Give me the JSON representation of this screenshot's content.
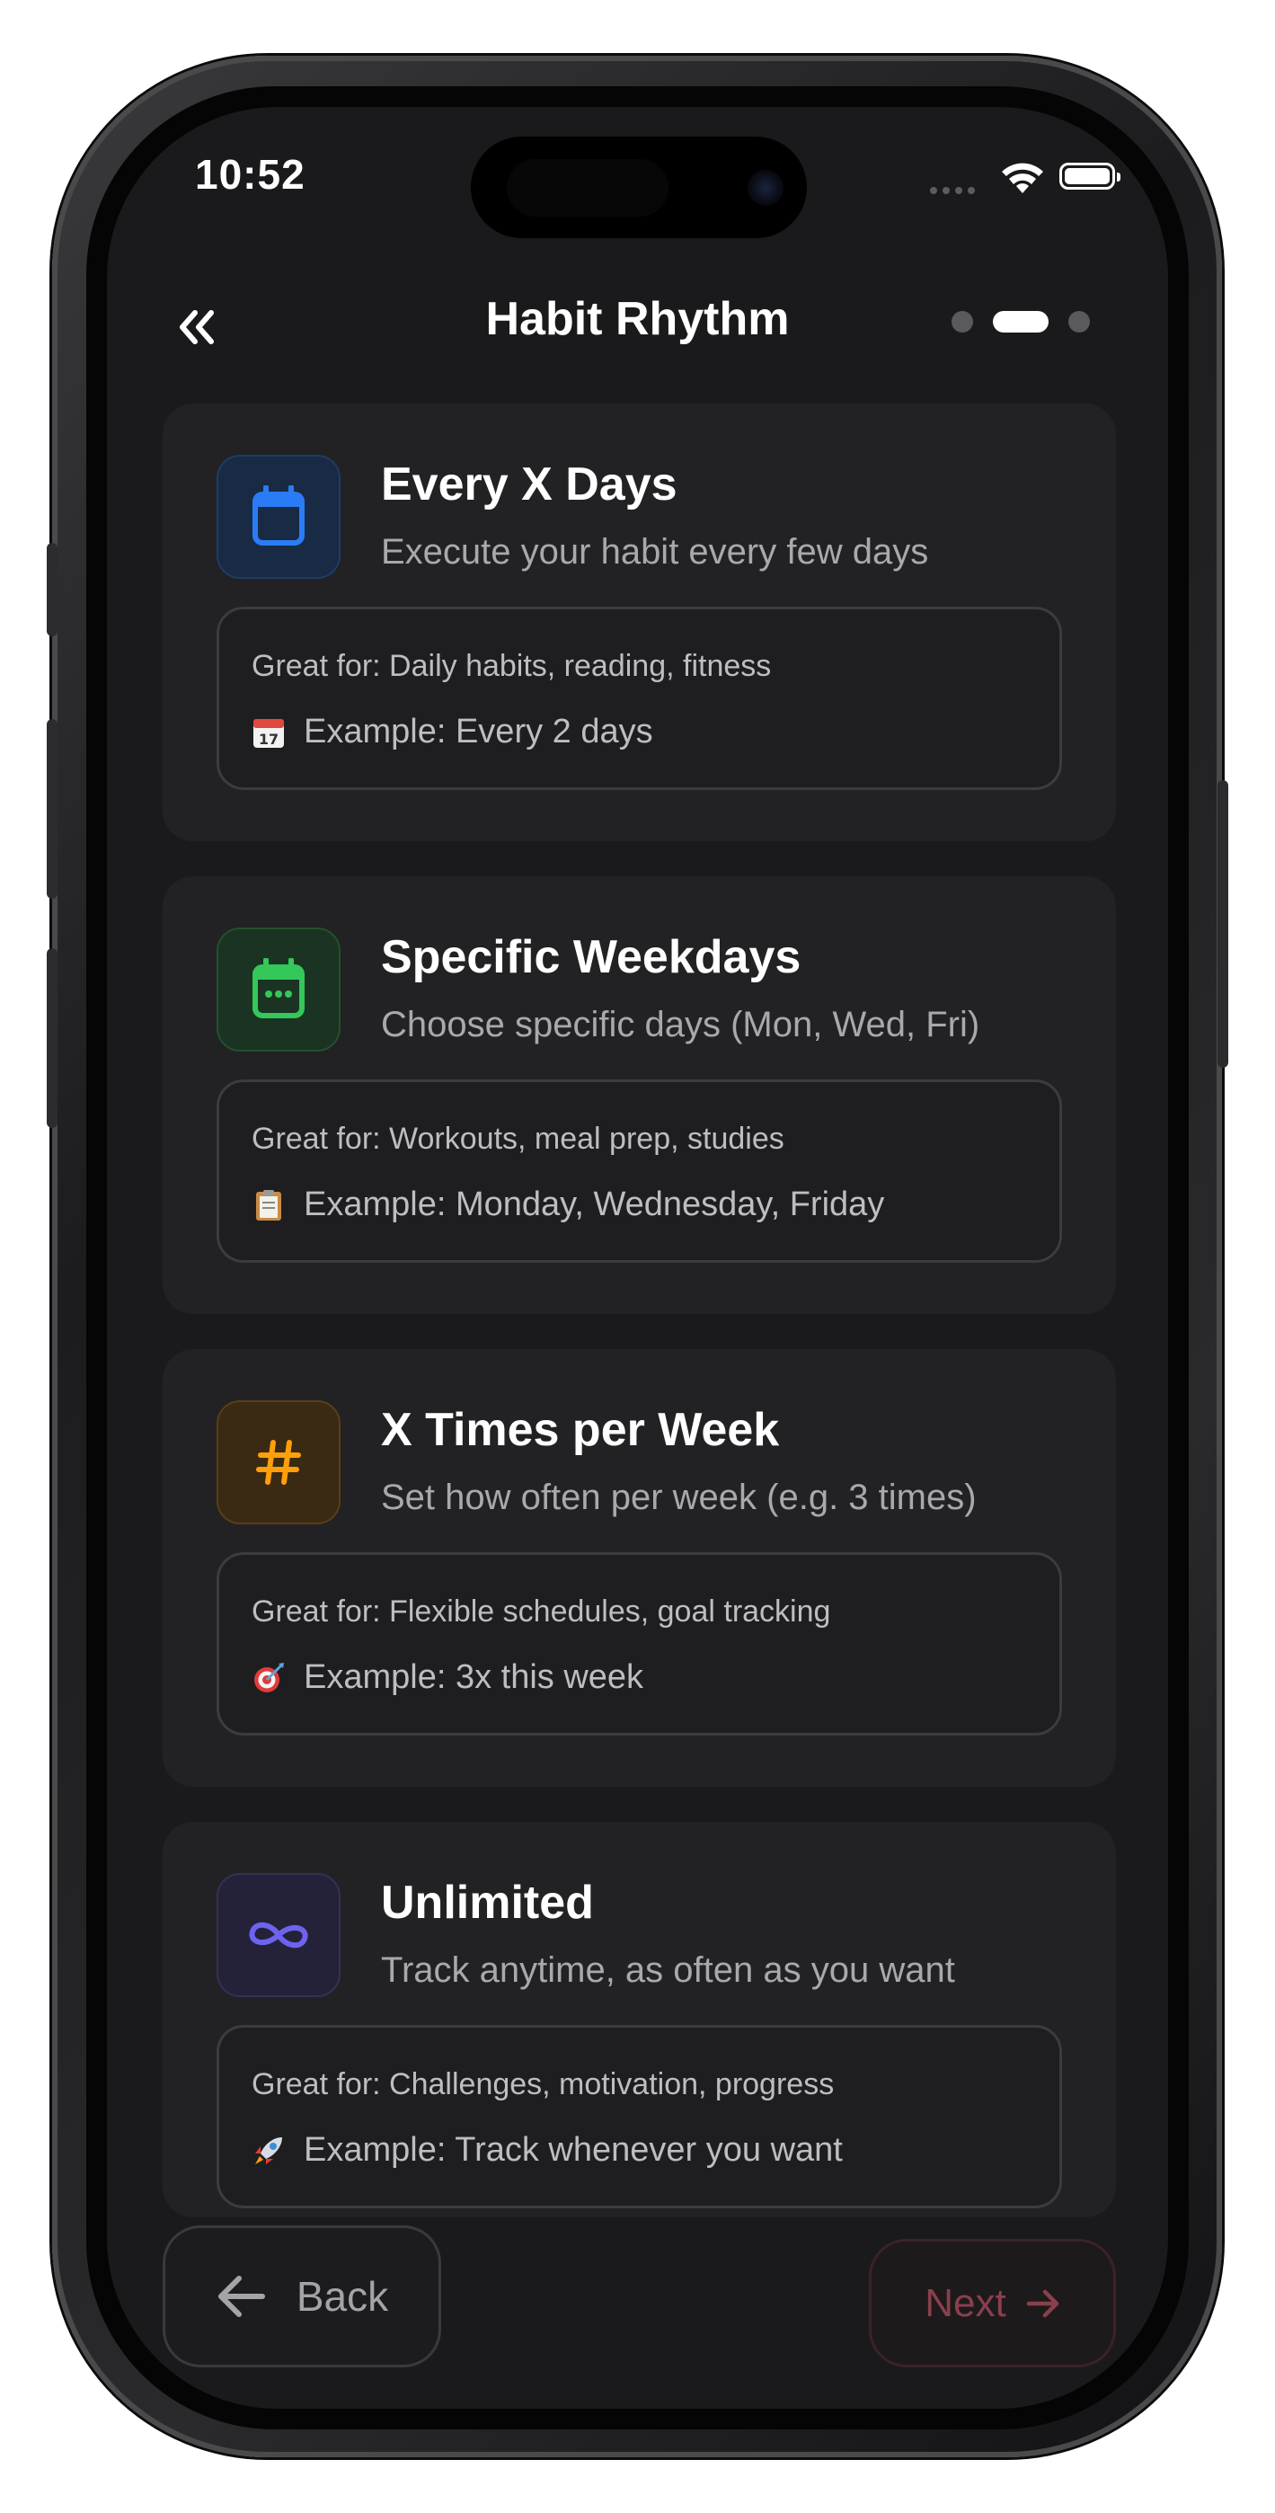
{
  "status_bar": {
    "time": "10:52"
  },
  "header": {
    "title": "Habit Rhythm",
    "progress": {
      "steps": 3,
      "current": 2
    }
  },
  "colors": {
    "blue": "#2a7cf6",
    "green": "#34c759",
    "orange": "#ff9f0a",
    "indigo": "#6e63f0",
    "next_accent": "#8a3f4c"
  },
  "options": [
    {
      "icon": "calendar-icon",
      "title": "Every X Days",
      "subtitle": "Execute your habit every few days",
      "great_for": "Great for: Daily habits, reading, fitness",
      "example_icon": "calendar-17-emoji",
      "example": "Example: Every 2 days"
    },
    {
      "icon": "calendar-dots-icon",
      "title": "Specific Weekdays",
      "subtitle": "Choose specific days (Mon, Wed, Fri)",
      "great_for": "Great for: Workouts, meal prep, studies",
      "example_icon": "clipboard-emoji",
      "example": "Example: Monday, Wednesday, Friday"
    },
    {
      "icon": "hashtag-icon",
      "title": "X Times per Week",
      "subtitle": "Set how often per week (e.g. 3 times)",
      "great_for": "Great for: Flexible schedules, goal tracking",
      "example_icon": "target-emoji",
      "example": "Example: 3x this week"
    },
    {
      "icon": "infinity-icon",
      "title": "Unlimited",
      "subtitle": "Track anytime, as often as you want",
      "great_for": "Great for: Challenges, motivation, progress",
      "example_icon": "rocket-emoji",
      "example": "Example: Track whenever you want"
    }
  ],
  "footer": {
    "back_label": "Back",
    "next_label": "Next"
  }
}
